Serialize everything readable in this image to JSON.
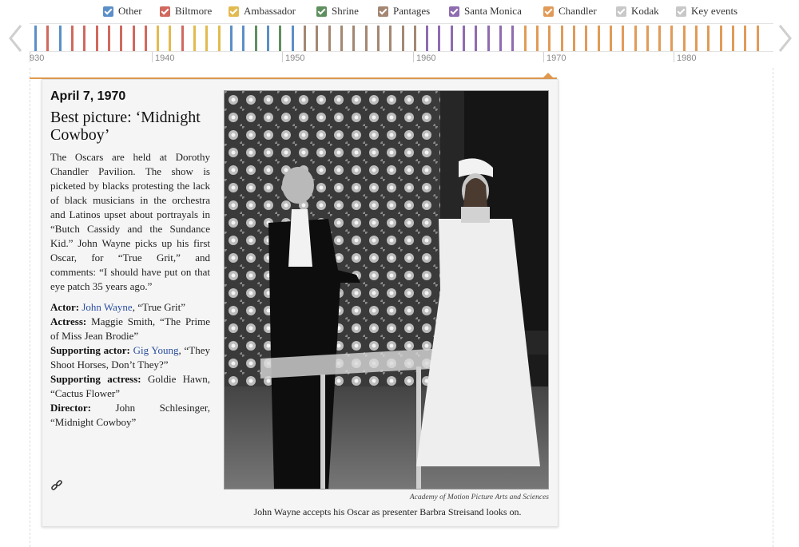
{
  "legend": [
    {
      "label": "Other",
      "color": "#5b8fc7"
    },
    {
      "label": "Biltmore",
      "color": "#d0695e"
    },
    {
      "label": "Ambassador",
      "color": "#e2bb4f"
    },
    {
      "label": "Shrine",
      "color": "#5f8f5f"
    },
    {
      "label": "Pantages",
      "color": "#a48772"
    },
    {
      "label": "Santa Monica",
      "color": "#8f6bb0"
    },
    {
      "label": "Chandler",
      "color": "#e19b58"
    },
    {
      "label": "Kodak",
      "color": "#c8c8c8"
    },
    {
      "label": "Key events",
      "color": "#c8c8c8"
    }
  ],
  "nav": {
    "prev_icon": "chevron-left-icon",
    "next_icon": "chevron-right-icon"
  },
  "timeline": {
    "decades": [
      "930",
      "1940",
      "1950",
      "1960",
      "1970",
      "1980"
    ],
    "selected_year": "1970",
    "ticks": [
      "Other",
      "Biltmore",
      "Other",
      "Biltmore",
      "Biltmore",
      "Biltmore",
      "Biltmore",
      "Biltmore",
      "Biltmore",
      "Biltmore",
      "Ambassador",
      "Ambassador",
      "Biltmore",
      "Ambassador",
      "Ambassador",
      "Ambassador",
      "Other",
      "Other",
      "Shrine",
      "Other",
      "Shrine",
      "Other",
      "Pantages",
      "Pantages",
      "Pantages",
      "Pantages",
      "Pantages",
      "Pantages",
      "Pantages",
      "Pantages",
      "Pantages",
      "Pantages",
      "Santa Monica",
      "Santa Monica",
      "Santa Monica",
      "Santa Monica",
      "Santa Monica",
      "Santa Monica",
      "Santa Monica",
      "Santa Monica",
      "Chandler",
      "Chandler",
      "Chandler",
      "Chandler",
      "Chandler",
      "Chandler",
      "Chandler",
      "Chandler",
      "Chandler",
      "Chandler",
      "Chandler",
      "Chandler",
      "Chandler",
      "Chandler",
      "Chandler",
      "Chandler",
      "Chandler",
      "Chandler",
      "Chandler",
      "Chandler"
    ]
  },
  "entry": {
    "date": "April 7, 1970",
    "title": "Best picture: ‘Midnight Cowboy’",
    "body": "The Oscars are held at Dorothy Chandler Pavilion. The show is picketed by blacks protesting the lack of black musicians in the orchestra and Latinos upset about portrayals in “Butch Cassidy and the Sundance Kid.” John Wayne picks up his first Oscar, for “True Grit,” and comments: “I should have put on that eye patch 35 years ago.”",
    "credits": [
      {
        "role": "Actor:",
        "name": "John Wayne",
        "linked": true,
        "film": ", “True Grit”"
      },
      {
        "role": "Actress:",
        "name": "Maggie Smith",
        "linked": false,
        "film": ", “The Prime of Miss Jean Brodie”"
      },
      {
        "role": "Supporting actor:",
        "name": "Gig Young",
        "linked": true,
        "film": ", “They Shoot Horses, Don’t They?”"
      },
      {
        "role": "Supporting actress:",
        "name": "Goldie Hawn",
        "linked": false,
        "film": ", “Cactus Flower”"
      },
      {
        "role": "Director:",
        "name": "John Schlesinger",
        "linked": false,
        "film": ", “Midnight Cowboy”"
      }
    ],
    "permalink_icon": "link-icon",
    "photo_credit": "Academy of Motion Picture Arts and Sciences",
    "caption": "John Wayne accepts his Oscar as presenter Barbra Streisand looks on."
  }
}
